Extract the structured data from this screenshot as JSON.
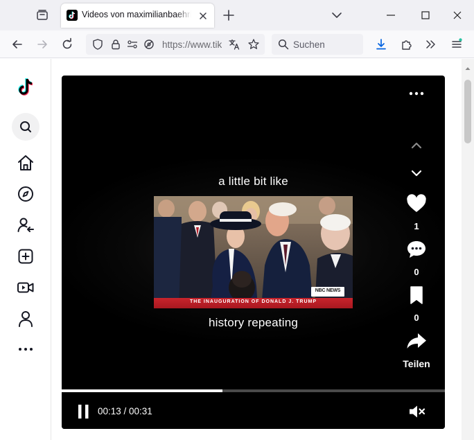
{
  "browser": {
    "tab_title": "Videos von maximilianbaehring",
    "url": "https://www.tiktok.com",
    "search_placeholder": "Suchen"
  },
  "sidebar": {
    "items": [
      "tiktok-logo",
      "search",
      "home",
      "explore",
      "following",
      "upload",
      "live",
      "profile",
      "more"
    ]
  },
  "video": {
    "caption_top": "a little bit like",
    "caption_bottom": "history repeating",
    "chyron": "THE INAUGURATION OF DONALD J. TRUMP",
    "network_badge": "NBC NEWS",
    "progress": 0.42,
    "time": "00:13 / 00:31"
  },
  "actions": {
    "likes": "1",
    "comments": "0",
    "saves": "0",
    "share_label": "Teilen"
  },
  "colors": {
    "tiktok_cyan": "#25f4ee",
    "tiktok_red": "#fe2c55",
    "chyron_red": "#c8242c",
    "firefox_accent": "#0061e0"
  }
}
